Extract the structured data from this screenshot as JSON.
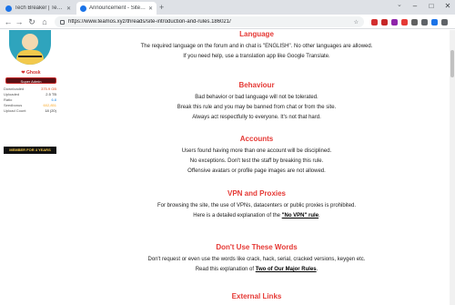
{
  "browser": {
    "tabs": [
      {
        "title": "Tech Breaker | Teamos OS - Your Ul...",
        "active": false,
        "favicon_color": "#1a73e8"
      },
      {
        "title": "Announcement - Site Introductio...",
        "active": true,
        "favicon_color": "#1a73e8"
      }
    ],
    "new_tab_label": "+",
    "tab_menu_label": "⌄",
    "window_controls": {
      "minimize": "–",
      "maximize": "□",
      "close": "✕"
    },
    "nav": {
      "back": "←",
      "forward": "→",
      "reload": "↻",
      "home": "⌂"
    },
    "url": "https://www.teamos.xyz/threads/site-introduction-and-rules.186021/",
    "extension_colors": [
      "#d32f2f",
      "#c62828",
      "#8e24aa",
      "#e53935",
      "#616161",
      "#5f6368",
      "#1a73e8",
      "#5f6368"
    ]
  },
  "sidebar": {
    "username": "❤ Ghosk",
    "rank": "Super Admin",
    "stats": [
      {
        "label": "Downloaded",
        "value": "375.9 GB",
        "color": "#e64a19"
      },
      {
        "label": "Uploaded",
        "value": "2.5 TB",
        "color": "#333333"
      },
      {
        "label": "Ratio",
        "value": "6.8",
        "color": "#1e88e5"
      },
      {
        "label": "Seedbonus",
        "value": "602,851",
        "color": "#f9a825"
      },
      {
        "label": "Upload Count",
        "value": "18 (20)",
        "color": "#333333"
      }
    ],
    "member_badge": "MEMBER FOR 4 YEARS"
  },
  "sections": [
    {
      "heading": "Language",
      "lines": [
        {
          "parts": [
            {
              "text": "The required language on the forum and in chat is \"ENGLISH\". No other languages are allowed."
            }
          ]
        },
        {
          "parts": [
            {
              "text": "If you need help, use a translation app like Google Translate."
            }
          ]
        }
      ]
    },
    {
      "heading": "Behaviour",
      "lines": [
        {
          "parts": [
            {
              "text": "Bad behavior or bad language will not be tolerated."
            }
          ]
        },
        {
          "parts": [
            {
              "text": "Break this rule and you may be banned from chat or from the site."
            }
          ]
        },
        {
          "parts": [
            {
              "text": "Always act respectfully to everyone. It's not that hard."
            }
          ]
        }
      ]
    },
    {
      "heading": "Accounts",
      "lines": [
        {
          "parts": [
            {
              "text": "Users found having more than one account will be disciplined."
            }
          ]
        },
        {
          "parts": [
            {
              "text": "No exceptions. Don't test the staff by breaking this rule."
            }
          ]
        },
        {
          "parts": [
            {
              "text": "Offensive avatars or profile page images are not allowed."
            }
          ]
        }
      ]
    },
    {
      "heading": "VPN and Proxies",
      "lines": [
        {
          "parts": [
            {
              "text": "For browsing the site, the use of VPNs, datacenters or public proxies is prohibited."
            }
          ]
        },
        {
          "parts": [
            {
              "text": "Here is a detailed explanation of the "
            },
            {
              "text": "\"No VPN\" rule",
              "link": true
            },
            {
              "text": "."
            }
          ]
        }
      ]
    },
    {
      "heading": "Don't Use These Words",
      "lines": [
        {
          "parts": [
            {
              "text": "Don't request or even use the words like crack, hack, serial, cracked versions, keygen etc."
            }
          ]
        },
        {
          "parts": [
            {
              "text": "Read this explanation of "
            },
            {
              "text": "Two of Our Major Rules",
              "link": true
            },
            {
              "text": "."
            }
          ]
        }
      ]
    },
    {
      "heading": "External Links",
      "lines": []
    }
  ]
}
